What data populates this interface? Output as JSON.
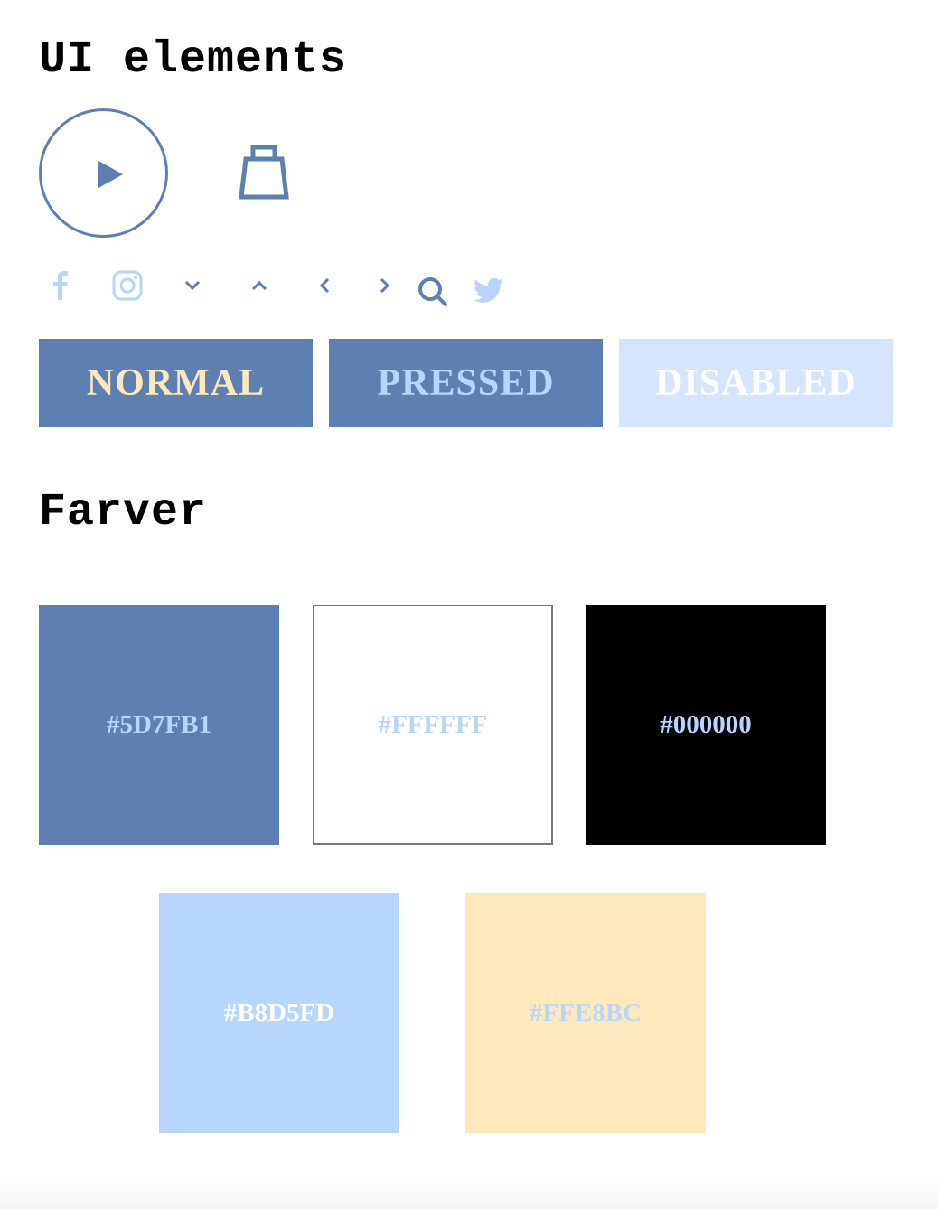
{
  "sections": {
    "ui_elements_title": "UI elements",
    "colors_title": "Farver"
  },
  "icons": {
    "play": "play-icon",
    "bag": "shopping-bag-icon",
    "row": [
      "facebook-icon",
      "instagram-icon",
      "chevron-down-icon",
      "chevron-up-icon",
      "chevron-left-icon",
      "chevron-right-icon",
      "search-icon",
      "twitter-icon"
    ]
  },
  "buttons": {
    "normal": "NORMAL",
    "pressed": "PRESSED",
    "disabled": "DISABLED"
  },
  "swatches": [
    {
      "hex": "#5D7FB1",
      "color": "#5D7FB1",
      "text_color": "#B8D5FD"
    },
    {
      "hex": "#FFFFFF",
      "color": "#FFFFFF",
      "text_color": "#B8D5FD"
    },
    {
      "hex": "#000000",
      "color": "#000000",
      "text_color": "#B8D5FD"
    },
    {
      "hex": "#B8D5FD",
      "color": "#B8D5FD",
      "text_color": "#FFFFFF"
    },
    {
      "hex": "#FFE8BC",
      "color": "#FFE8BC",
      "text_color": "#B8D5FD"
    }
  ],
  "palette": {
    "primary": "#5D7FB1",
    "light_blue": "#B8D5FD",
    "cream": "#FFE8BC",
    "disabled_bg": "#D6E5FC"
  }
}
